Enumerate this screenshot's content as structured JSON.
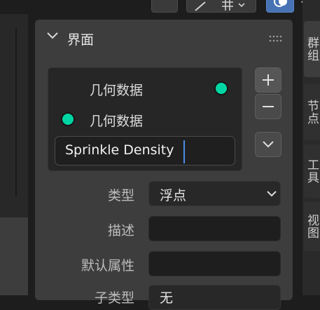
{
  "panel": {
    "title": "界面"
  },
  "interface": {
    "sockets": [
      {
        "label": "几何数据",
        "color": "#00d6a3"
      },
      {
        "label": "几何数据",
        "color": "#00d6a3"
      }
    ],
    "name_value": "Sprinkle Density"
  },
  "properties": {
    "type": {
      "label": "类型",
      "value": "浮点"
    },
    "description": {
      "label": "描述",
      "value": ""
    },
    "default_attribute": {
      "label": "默认属性",
      "value": ""
    },
    "subtype": {
      "label": "子类型",
      "value": "无"
    }
  },
  "side_tabs": [
    "群组",
    "节点",
    "工具",
    "视图"
  ],
  "icons": {
    "collapse": "chevron-down-icon",
    "drag": "grip-icon",
    "add": "plus-icon",
    "remove": "minus-icon",
    "move": "chevron-down-icon",
    "select": "chevron-down-icon"
  }
}
